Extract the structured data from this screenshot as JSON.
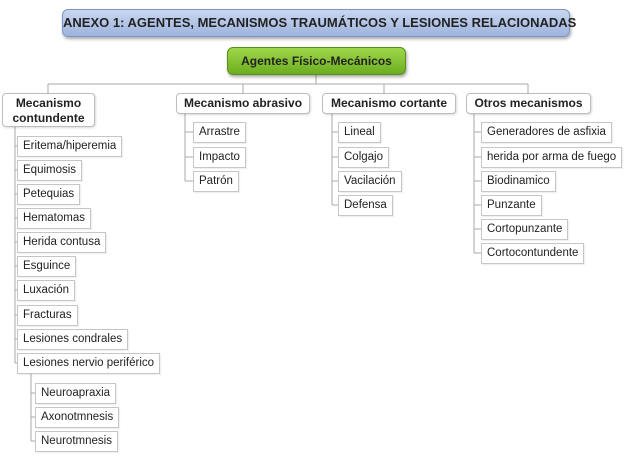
{
  "title": "ANEXO 1: AGENTES, MECANISMOS TRAUMÁTICOS Y LESIONES RELACIONADAS",
  "root": "Agentes Físico-Mecánicos",
  "branches": [
    {
      "label": "Mecanismo contundente",
      "label_lines": [
        "Mecanismo",
        "contundente"
      ],
      "items": [
        "Eritema/hiperemia",
        "Equimosis",
        "Petequias",
        "Hematomas",
        "Herida contusa",
        "Esguince",
        "Luxación",
        "Fracturas",
        "Lesiones condrales",
        "Lesiones nervio periférico"
      ],
      "sub_items": [
        "Neuroapraxia",
        "Axonotmnesis",
        "Neurotmnesis"
      ]
    },
    {
      "label": "Mecanismo abrasivo",
      "items": [
        "Arrastre",
        "Impacto",
        "Patrón"
      ]
    },
    {
      "label": "Mecanismo cortante",
      "items": [
        "Lineal",
        "Colgajo",
        "Vacilación",
        "Defensa"
      ]
    },
    {
      "label": "Otros mecanismos",
      "items": [
        "Generadores de asfixia",
        "herida por arma de fuego",
        "Biodinamico",
        "Punzante",
        "Cortopunzante",
        "Cortocontundente"
      ]
    }
  ],
  "colors": {
    "title_bg": "#aec0e6",
    "root_bg": "#84c237",
    "line": "#a8a8a8",
    "box_border": "#c6c6c6"
  }
}
